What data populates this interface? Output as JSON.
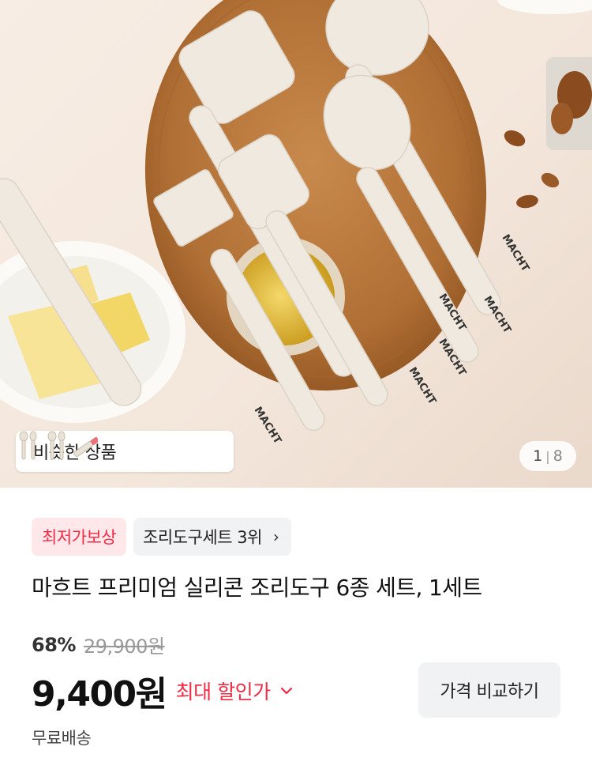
{
  "product_image": {
    "alt": "MACHT",
    "brand_mark": "MACHT",
    "counter_current": "1",
    "counter_total": "8"
  },
  "similar_products": {
    "label": "비슷한 상품"
  },
  "badges": {
    "lowest_price": "최저가보상",
    "ranking": "조리도구세트 3위"
  },
  "product": {
    "title": "마흐트 프리미엄 실리콘 조리도구 6종 세트, 1세트"
  },
  "pricing": {
    "discount_percent": "68%",
    "original_price": "29,900원",
    "sale_price": "9,400원",
    "max_discount_label": "최대 할인가",
    "compare_button": "가격 비교하기"
  },
  "shipping": {
    "label": "무료배송"
  },
  "colors": {
    "accent_red": "#f02b45",
    "badge_red_bg": "#ffe7ea",
    "chip_gray_bg": "#f1f2f4"
  }
}
